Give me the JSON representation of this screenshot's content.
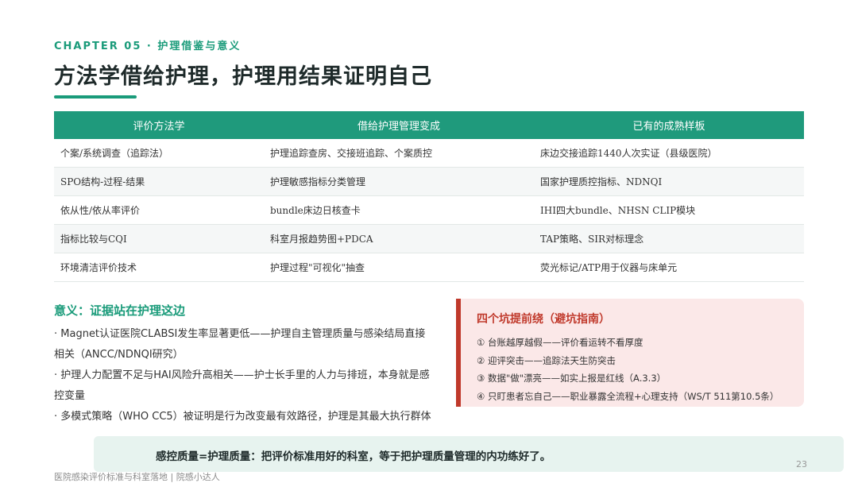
{
  "header": {
    "chapter": "CHAPTER 05 · 护理借鉴与意义",
    "title": "方法学借给护理，护理用结果证明自己"
  },
  "table": {
    "headers": [
      "评价方法学",
      "借给护理管理变成",
      "已有的成熟样板"
    ],
    "rows": [
      [
        "个案/系统调查（追踪法）",
        "护理追踪查房、交接班追踪、个案质控",
        "床边交接追踪1440人次实证（县级医院）"
      ],
      [
        "SPO结构-过程-结果",
        "护理敏感指标分类管理",
        "国家护理质控指标、NDNQI"
      ],
      [
        "依从性/依从率评价",
        "bundle床边日核查卡",
        "IHI四大bundle、NHSN CLIP模块"
      ],
      [
        "指标比较与CQI",
        "科室月报趋势图+PDCA",
        "TAP策略、SIR对标理念"
      ],
      [
        "环境清洁评价技术",
        "护理过程\"可视化\"抽查",
        "荧光标记/ATP用于仪器与床单元"
      ]
    ]
  },
  "significance": {
    "title": "意义：证据站在护理这边",
    "points": [
      "· Magnet认证医院CLABSI发生率显著更低——护理自主管理质量与感染结局直接相关（ANCC/NDNQI研究）",
      "· 护理人力配置不足与HAI风险升高相关——护士长手里的人力与排班，本身就是感控变量",
      "· 多模式策略（WHO CC5）被证明是行为改变最有效路径，护理是其最大执行群体"
    ]
  },
  "pitfalls": {
    "title": "四个坑提前绕（避坑指南）",
    "items": [
      "① 台账越厚越假——评价看运转不看厚度",
      "② 迎评突击——追踪法天生防突击",
      "③ 数据\"做\"漂亮——如实上报是红线（A.3.3）",
      "④ 只盯患者忘自己——职业暴露全流程+心理支持（WS/T 511第10.5条）"
    ]
  },
  "banner": {
    "text": "感控质量=护理质量：把评价标准用好的科室，等于把护理质量管理的内功练好了。",
    "page_number": "23"
  },
  "footer": {
    "text": "医院感染评价标准与科室落地 | 院感小达人"
  },
  "colors": {
    "accent": "#1a9b7a",
    "warning": "#c0392b"
  }
}
